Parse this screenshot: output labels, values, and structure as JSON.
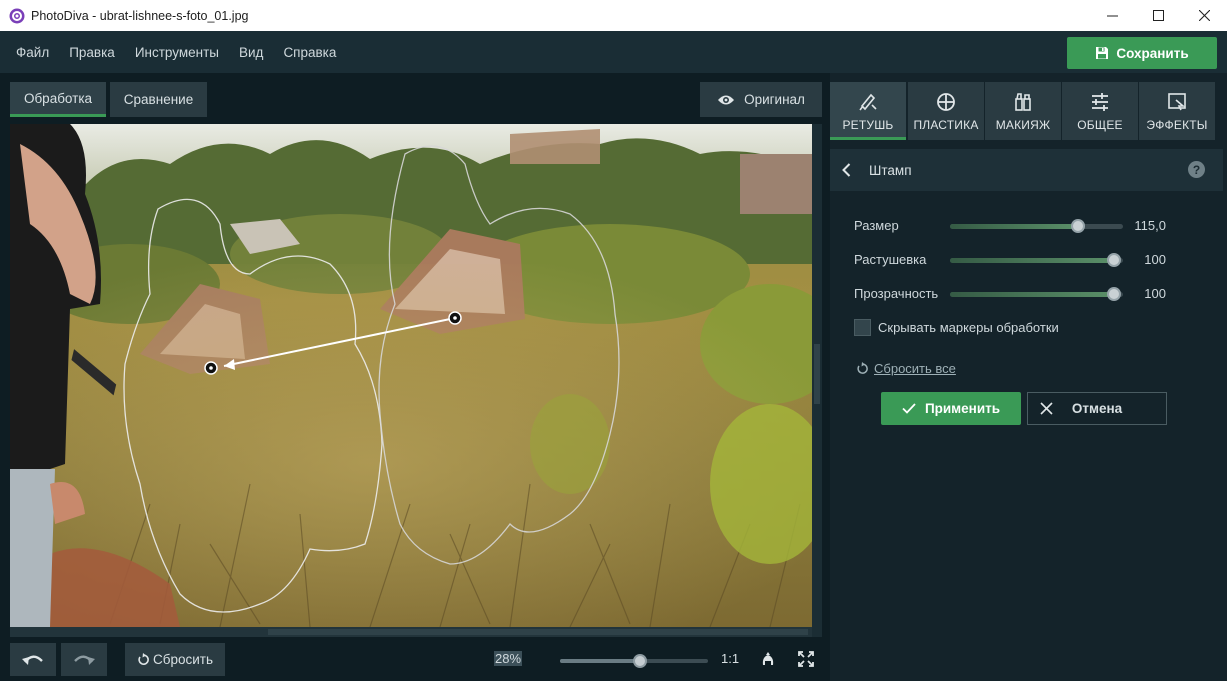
{
  "window": {
    "title": "PhotoDiva - ubrat-lishnee-s-foto_01.jpg",
    "app_icon": "photodiva-logo-icon",
    "controls": [
      "minimize-icon",
      "maximize-icon",
      "close-icon"
    ]
  },
  "menu": {
    "items": [
      "Файл",
      "Правка",
      "Инструменты",
      "Вид",
      "Справка"
    ],
    "save_label": "Сохранить"
  },
  "workspace": {
    "tabs": [
      "Обработка",
      "Сравнение"
    ],
    "active_tab": "Обработка",
    "original_label": "Оригинал",
    "reset_label": "Сбросить",
    "zoom_label": "28%",
    "zoom_level": 0.54,
    "one_to_one_label": "1:1"
  },
  "panel": {
    "tabs": [
      {
        "label": "РЕТУШЬ",
        "icon": "retouch-brush-icon"
      },
      {
        "label": "ПЛАСТИКА",
        "icon": "plastic-target-icon"
      },
      {
        "label": "МАКИЯЖ",
        "icon": "makeup-bottles-icon"
      },
      {
        "label": "ОБЩЕЕ",
        "icon": "sliders-icon"
      },
      {
        "label": "ЭФФЕКТЫ",
        "icon": "effects-frame-icon"
      }
    ],
    "active_tab": "РЕТУШЬ",
    "section_title": "Штамп",
    "help_label": "?",
    "params": [
      {
        "label": "Размер",
        "value": "115,0",
        "level": 0.74
      },
      {
        "label": "Растушевка",
        "value": "100",
        "level": 0.95
      },
      {
        "label": "Прозрачность",
        "value": "100",
        "level": 0.95
      }
    ],
    "hide_markers_label": "Скрывать маркеры обработки",
    "hide_markers_checked": false,
    "reset_all_label": "Сбросить все",
    "apply_label": "Применить",
    "cancel_label": "Отмена"
  },
  "colors": {
    "accent": "#3a9a56",
    "background": "#14232a",
    "panel_tab": "#2a3b42"
  }
}
